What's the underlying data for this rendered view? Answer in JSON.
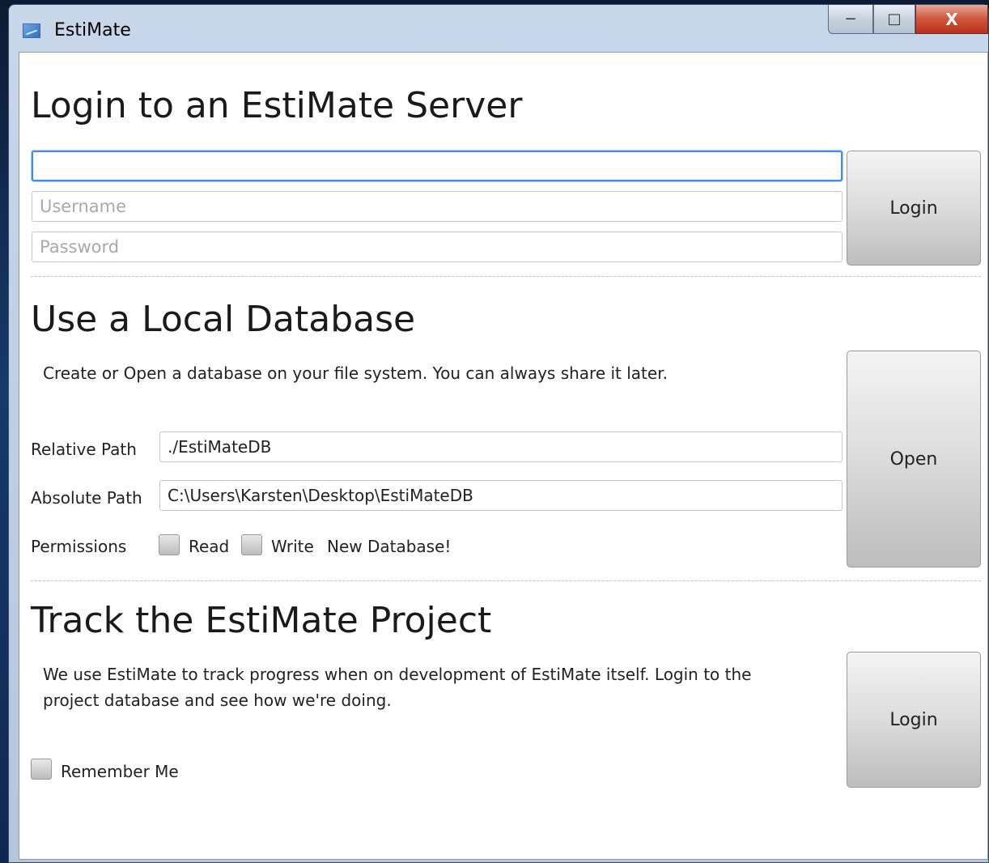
{
  "window": {
    "title": "EstiMate",
    "min_glyph": "−",
    "max_glyph": "□",
    "close_glyph": "X"
  },
  "server": {
    "heading": "Login to an EstiMate Server",
    "server_value": "",
    "username_placeholder": "Username",
    "password_placeholder": "Password",
    "login_label": "Login"
  },
  "local": {
    "heading": "Use a Local Database",
    "description": "Create or Open a database on your file system.  You can always share it later.",
    "relative_label": "Relative Path",
    "relative_value": "./EstiMateDB",
    "absolute_label": "Absolute Path",
    "absolute_value": "C:\\Users\\Karsten\\Desktop\\EstiMateDB",
    "permissions_label": "Permissions",
    "read_label": "Read",
    "write_label": "Write",
    "status": "New Database!",
    "open_label": "Open"
  },
  "project": {
    "heading": "Track the EstiMate Project",
    "description_line1": "We use EstiMate to track progress when on development of EstiMate itself.  Login to the",
    "description_line2": "project database and see how we're doing.",
    "remember_label": "Remember Me",
    "login_label": "Login"
  }
}
